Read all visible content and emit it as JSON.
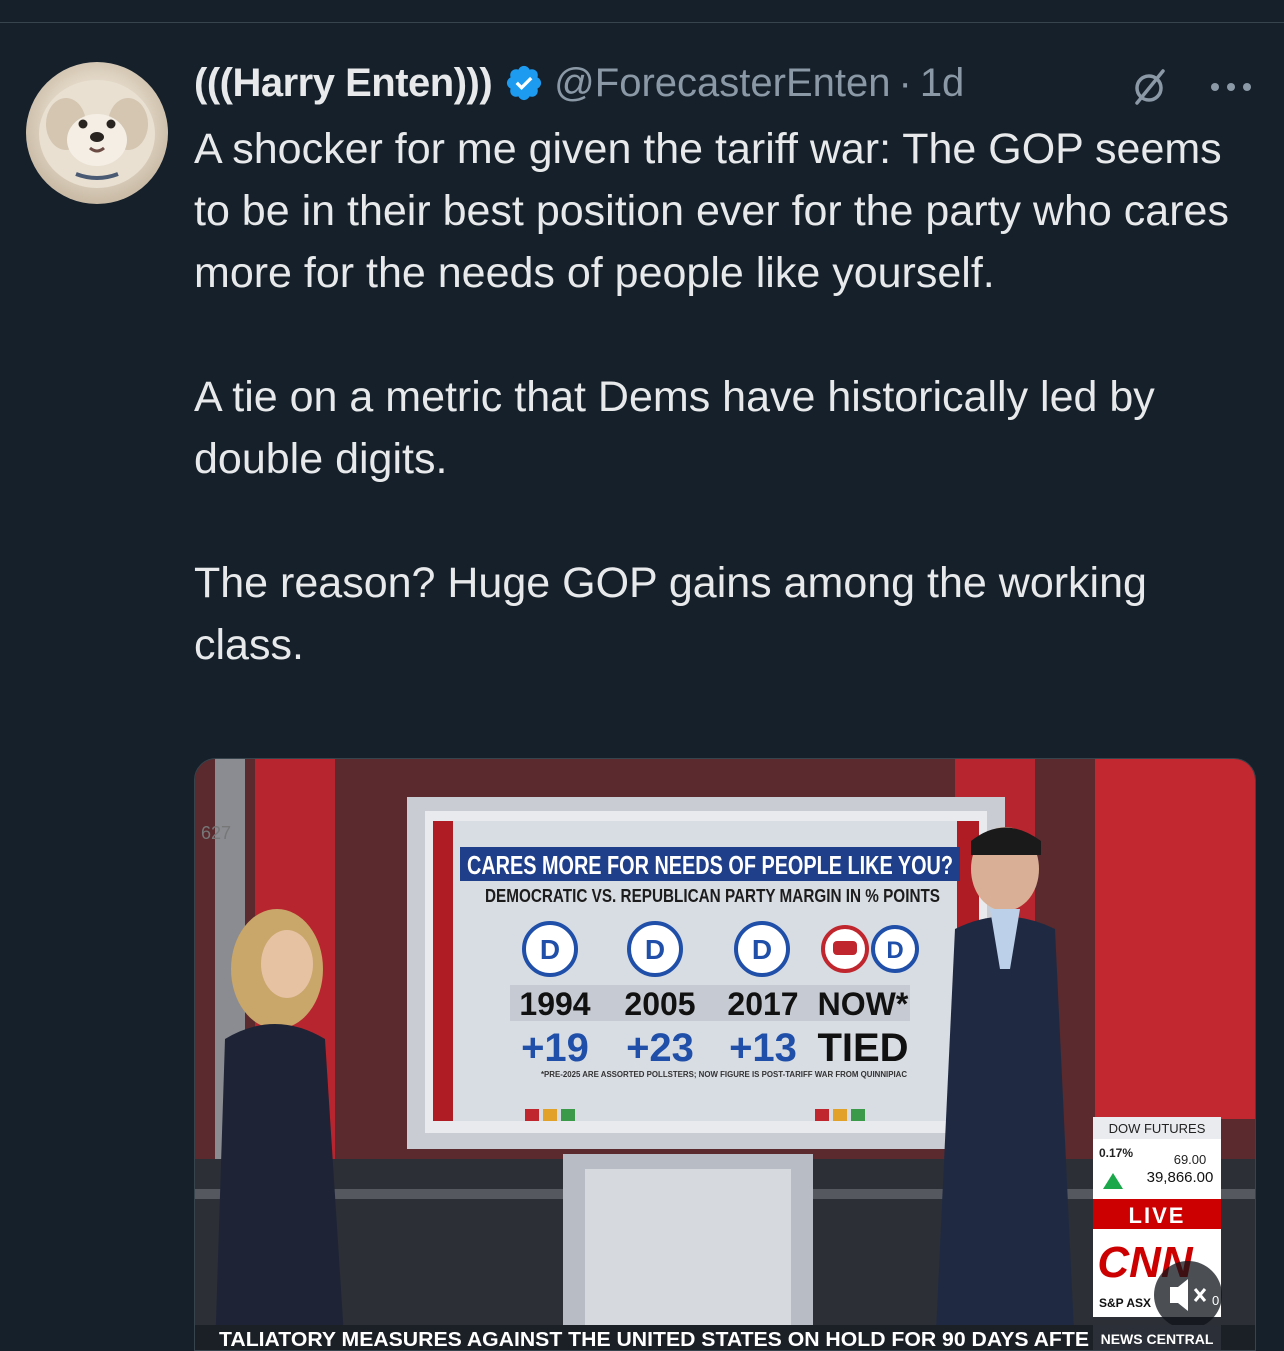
{
  "tweet": {
    "display_name": "(((Harry Enten)))",
    "handle": "@ForecasterEnten",
    "separator": "·",
    "time": "1d",
    "paragraphs": [
      "A shocker for me given the tariff war: The GOP seems to be in their best position ever for the party who cares more for the needs of people like yourself.",
      "A tie on a metric that Dems have historically led by double digits.",
      "The reason? Huge GOP gains among the working class."
    ]
  },
  "icons": {
    "verified": "verified-badge-icon",
    "grok": "grok-icon",
    "more": "more-options-icon",
    "mute": "mute-icon"
  },
  "colors": {
    "background": "#15202b",
    "verified": "#1d9bf0",
    "secondary_text": "#8b98a5"
  },
  "media": {
    "board_title": "CARES MORE FOR NEEDS OF PEOPLE LIKE YOU?",
    "board_subtitle": "DEMOCRATIC VS. REPUBLICAN PARTY MARGIN IN % POINTS",
    "years": [
      "1994",
      "2005",
      "2017",
      "NOW*"
    ],
    "margins": [
      "+19",
      "+23",
      "+13",
      "TIED"
    ],
    "party_letter": "D",
    "footnote": "*PRE-2025 ARE ASSORTED POLLSTERS; NOW FIGURE IS POST-TARIFF WAR FROM QUINNIPIAC",
    "ticker_title": "DOW FUTURES",
    "ticker_pct": "0.17%",
    "ticker_change": "69.00",
    "ticker_value": "39,866.00",
    "live": "LIVE",
    "network": "CNN",
    "index_label": "S&P ASX",
    "mute_label": "0",
    "crawl": "TALIATORY MEASURES AGAINST THE UNITED STATES ON HOLD FOR 90 DAYS AFTE",
    "news_central": "NEWS CENTRAL"
  }
}
